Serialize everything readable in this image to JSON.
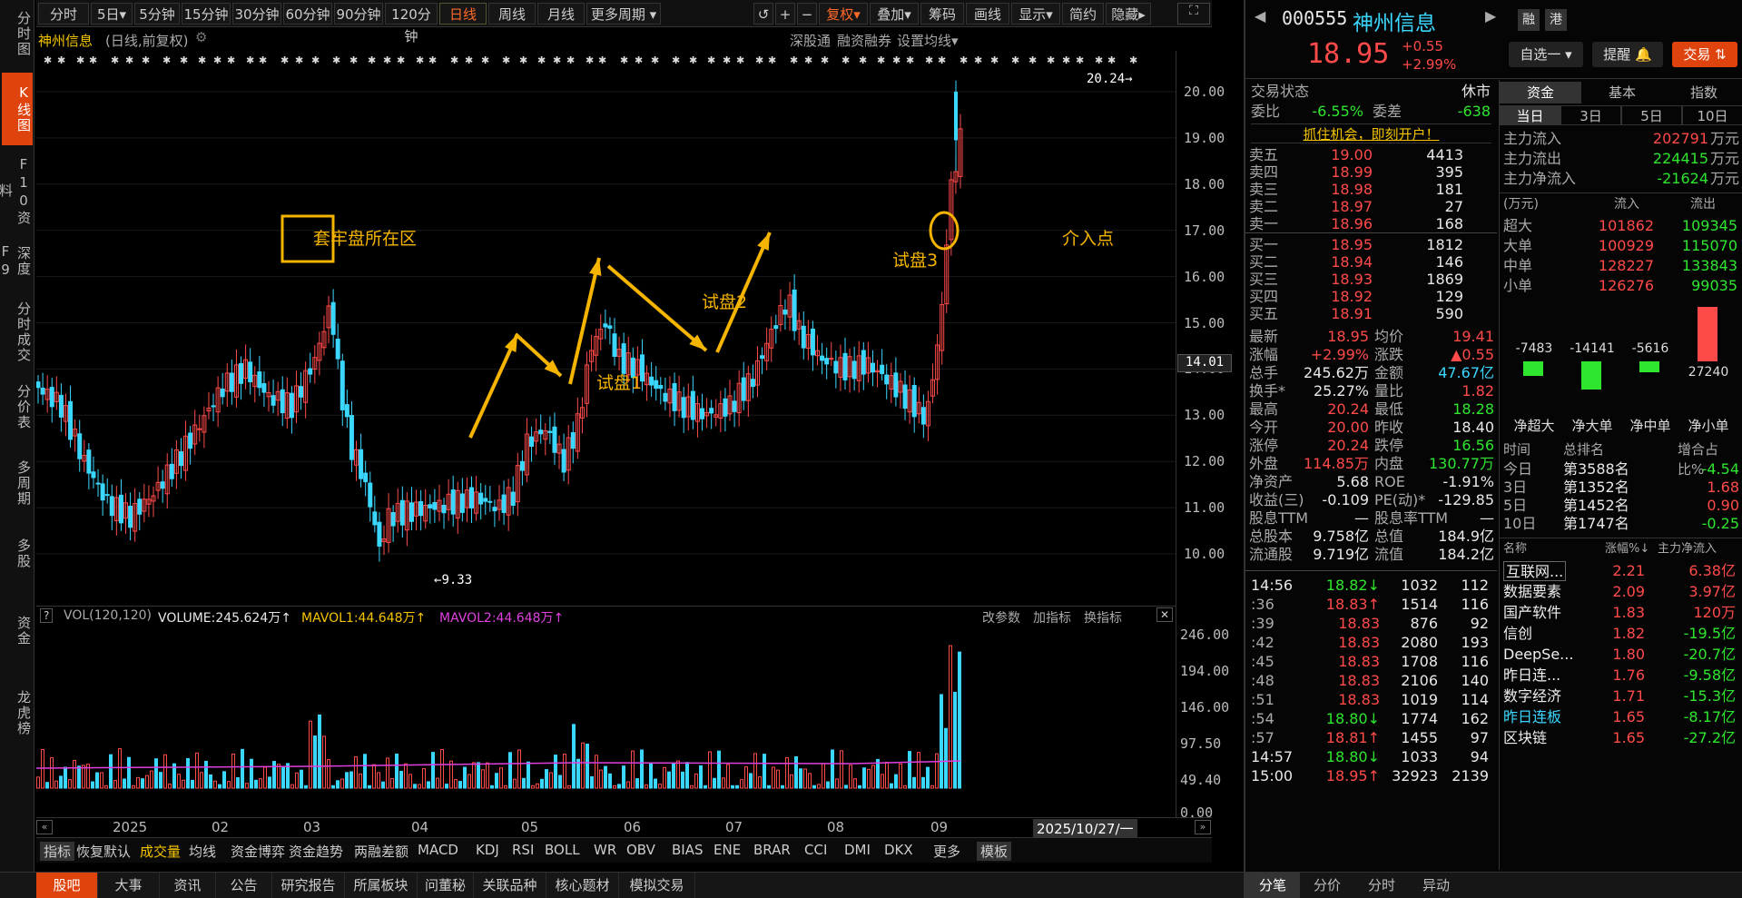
{
  "left_nav": [
    {
      "label": "分时图"
    },
    {
      "label": "K线图",
      "active": true
    },
    {
      "label": "F10资料"
    },
    {
      "label": "深度F9"
    },
    {
      "label": "分时成交"
    },
    {
      "label": "分价表"
    },
    {
      "label": "多周期"
    },
    {
      "label": "多股"
    },
    {
      "label": "资金"
    },
    {
      "label": "龙虎榜"
    }
  ],
  "toolbar": {
    "periods": [
      "分时",
      "5日▾",
      "5分钟",
      "15分钟",
      "30分钟",
      "60分钟",
      "90分钟",
      "120分钟",
      "日线",
      "周线",
      "月线",
      "更多周期 ▾"
    ],
    "active": "日线",
    "tools": [
      "复权▾",
      "叠加▾",
      "筹码",
      "画线",
      "显示▾",
      "简约",
      "隐藏▸"
    ]
  },
  "chart_header": {
    "name": "神州信息",
    "mode": "(日线,前复权)",
    "links": [
      "深股通",
      "融资融券",
      "设置均线▾"
    ]
  },
  "y_axis": [
    "20.00",
    "19.00",
    "18.00",
    "17.00",
    "16.00",
    "15.00",
    "14.00",
    "13.00",
    "12.00",
    "11.00",
    "10.00"
  ],
  "cursor_price": "14.01",
  "high_label": "20.24",
  "low_label": "9.33",
  "annotations": {
    "trapped": "套牢盘所在区",
    "t1": "试盘1",
    "t2": "试盘2",
    "t3": "试盘3",
    "entry": "介入点"
  },
  "x_axis": [
    "2025",
    "02",
    "03",
    "04",
    "05",
    "06",
    "07",
    "08",
    "09",
    "2025/10/27/一"
  ],
  "volume": {
    "title": "VOL(120,120)",
    "vol": "VOLUME:245.624万↑",
    "ma1": "MAVOL1:44.648万↑",
    "ma2": "MAVOL2:44.648万↑",
    "links": [
      "改参数",
      "加指标",
      "换指标"
    ],
    "y_axis": [
      "246.00",
      "194.00",
      "146.00",
      "97.50",
      "49.40",
      "0.00"
    ]
  },
  "chart_data": {
    "type": "candlestick",
    "x_range": [
      "2025-01",
      "2025-10-27"
    ],
    "y_range": [
      9.33,
      20.24
    ],
    "high": 20.24,
    "low": 9.33,
    "last_close": 18.95
  },
  "indicators": [
    "指标",
    "恢复默认",
    "成交量",
    "均线",
    "资金博弈",
    "资金趋势",
    "两融差额",
    "MACD",
    "KDJ",
    "RSI",
    "BOLL",
    "WR",
    "OBV",
    "BIAS",
    "ENE",
    "BRAR",
    "CCI",
    "DMI",
    "DKX",
    "更多",
    "模板"
  ],
  "bottom_tabs": [
    "股吧",
    "大事",
    "资讯",
    "公告",
    "研究报告",
    "所属板块",
    "问董秘",
    "关联品种",
    "核心题材",
    "模拟交易"
  ],
  "stock": {
    "code": "000555",
    "name": "神州信息",
    "price": "18.95",
    "chg": "+0.55",
    "pct": "+2.99%",
    "badges": [
      "融",
      "港"
    ]
  },
  "buttons": {
    "watch": "自选一 ▾",
    "alert": "提醒 🔔",
    "trade": "交易 ⇅"
  },
  "status": {
    "label": "交易状态",
    "value": "休市",
    "wb_label": "委比",
    "wb": "-6.55%",
    "wc_label": "委差",
    "wc": "-638",
    "promo": "抓住机会，即刻开户！"
  },
  "asks": [
    {
      "l": "卖五",
      "p": "19.00",
      "v": "4413"
    },
    {
      "l": "卖四",
      "p": "18.99",
      "v": "395"
    },
    {
      "l": "卖三",
      "p": "18.98",
      "v": "181"
    },
    {
      "l": "卖二",
      "p": "18.97",
      "v": "27"
    },
    {
      "l": "卖一",
      "p": "18.96",
      "v": "168"
    }
  ],
  "bids": [
    {
      "l": "买一",
      "p": "18.95",
      "v": "1812"
    },
    {
      "l": "买二",
      "p": "18.94",
      "v": "146"
    },
    {
      "l": "买三",
      "p": "18.93",
      "v": "1869"
    },
    {
      "l": "买四",
      "p": "18.92",
      "v": "129"
    },
    {
      "l": "买五",
      "p": "18.91",
      "v": "590"
    }
  ],
  "quote": [
    {
      "k1": "最新",
      "v1": "18.95",
      "c1": "red",
      "k2": "均价",
      "v2": "19.41",
      "c2": "red"
    },
    {
      "k1": "涨幅",
      "v1": "+2.99%",
      "c1": "red",
      "k2": "涨跌",
      "v2": "▲0.55",
      "c2": "red"
    },
    {
      "k1": "总手",
      "v1": "245.62万",
      "c1": "white",
      "k2": "金额",
      "v2": "47.67亿",
      "c2": "cyan"
    },
    {
      "k1": "换手*",
      "v1": "25.27%",
      "c1": "white",
      "k2": "量比",
      "v2": "1.82",
      "c2": "red"
    },
    {
      "k1": "最高",
      "v1": "20.24",
      "c1": "red",
      "k2": "最低",
      "v2": "18.28",
      "c2": "green"
    },
    {
      "k1": "今开",
      "v1": "20.00",
      "c1": "red",
      "k2": "昨收",
      "v2": "18.40",
      "c2": "white"
    },
    {
      "k1": "涨停",
      "v1": "20.24",
      "c1": "red",
      "k2": "跌停",
      "v2": "16.56",
      "c2": "green"
    },
    {
      "k1": "外盘",
      "v1": "114.85万",
      "c1": "red",
      "k2": "内盘",
      "v2": "130.77万",
      "c2": "green"
    },
    {
      "k1": "净资产",
      "v1": "5.68",
      "c1": "white",
      "k2": "ROE",
      "v2": "-1.91%",
      "c2": "white"
    },
    {
      "k1": "收益(三)",
      "v1": "-0.109",
      "c1": "white",
      "k2": "PE(动)*",
      "v2": "-129.85",
      "c2": "white"
    },
    {
      "k1": "股息TTM",
      "v1": "—",
      "c1": "white",
      "k2": "股息率TTM",
      "v2": "—",
      "c2": "white"
    },
    {
      "k1": "总股本",
      "v1": "9.758亿",
      "c1": "white",
      "k2": "总值",
      "v2": "184.9亿",
      "c2": "white"
    },
    {
      "k1": "流通股",
      "v1": "9.719亿",
      "c1": "white",
      "k2": "流值",
      "v2": "184.2亿",
      "c2": "white"
    }
  ],
  "ticks": [
    {
      "t": "14:56",
      "p": "18.82↓",
      "pc": "green",
      "v": "1032",
      "n": "112"
    },
    {
      "t": ":36",
      "p": "18.83↑",
      "pc": "red",
      "v": "1514",
      "n": "116"
    },
    {
      "t": ":39",
      "p": "18.83",
      "pc": "red",
      "v": "876",
      "n": "92"
    },
    {
      "t": ":42",
      "p": "18.83",
      "pc": "red",
      "v": "2080",
      "n": "193"
    },
    {
      "t": ":45",
      "p": "18.83",
      "pc": "red",
      "v": "1708",
      "n": "116"
    },
    {
      "t": ":48",
      "p": "18.83",
      "pc": "red",
      "v": "2106",
      "n": "140"
    },
    {
      "t": ":51",
      "p": "18.83",
      "pc": "red",
      "v": "1019",
      "n": "114"
    },
    {
      "t": ":54",
      "p": "18.80↓",
      "pc": "green",
      "v": "1774",
      "n": "162"
    },
    {
      "t": ":57",
      "p": "18.81↑",
      "pc": "red",
      "v": "1455",
      "n": "97"
    },
    {
      "t": "14:57",
      "p": "18.80↓",
      "pc": "green",
      "v": "1033",
      "n": "94"
    },
    {
      "t": "15:00",
      "p": "18.95↑",
      "pc": "red",
      "v": "32923",
      "n": "2139"
    }
  ],
  "right_tabs_top": [
    "资金",
    "基本",
    "指数"
  ],
  "periods_top": [
    "当日",
    "3日",
    "5日",
    "10日"
  ],
  "flow": [
    {
      "k": "主力流入",
      "v": "202791",
      "c": "red"
    },
    {
      "k": "主力流出",
      "v": "224415",
      "c": "green"
    },
    {
      "k": "主力净流入",
      "v": "-21624",
      "c": "green"
    }
  ],
  "flow_unit": "万元",
  "flow_head": [
    "(万元)",
    "流入",
    "流出"
  ],
  "flow_rows": [
    {
      "k": "超大",
      "i": "101862",
      "o": "109345"
    },
    {
      "k": "大单",
      "i": "100929",
      "o": "115070"
    },
    {
      "k": "中单",
      "i": "128227",
      "o": "133843"
    },
    {
      "k": "小单",
      "i": "126276",
      "o": "99035"
    }
  ],
  "netbars": [
    {
      "label": "净超大",
      "value": -7483
    },
    {
      "label": "净大单",
      "value": -14141
    },
    {
      "label": "净中单",
      "value": -5616
    },
    {
      "label": "净小单",
      "value": 27240
    }
  ],
  "rank_head": [
    "时间",
    "总排名",
    "增合占比%"
  ],
  "ranks": [
    {
      "t": "今日",
      "r": "第3588名",
      "p": "-4.54",
      "c": "green"
    },
    {
      "t": "3日",
      "r": "第1352名",
      "p": "1.68",
      "c": "red"
    },
    {
      "t": "5日",
      "r": "第1452名",
      "p": "0.90",
      "c": "red"
    },
    {
      "t": "10日",
      "r": "第1747名",
      "p": "-0.25",
      "c": "green"
    }
  ],
  "sector_head": [
    "名称",
    "涨幅%↓",
    "主力净流入"
  ],
  "sectors": [
    {
      "n": "互联网...",
      "p": "2.21",
      "f": "6.38亿",
      "fc": "red"
    },
    {
      "n": "数据要素",
      "p": "2.09",
      "f": "3.97亿",
      "fc": "red"
    },
    {
      "n": "国产软件",
      "p": "1.83",
      "f": "120万",
      "fc": "red"
    },
    {
      "n": "信创",
      "p": "1.82",
      "f": "-19.5亿",
      "fc": "green"
    },
    {
      "n": "DeepSe...",
      "p": "1.80",
      "f": "-20.7亿",
      "fc": "green"
    },
    {
      "n": "昨日连...",
      "p": "1.76",
      "f": "-9.58亿",
      "fc": "green"
    },
    {
      "n": "数字经济",
      "p": "1.71",
      "f": "-15.3亿",
      "fc": "green"
    },
    {
      "n": "昨日连板",
      "p": "1.65",
      "f": "-8.17亿",
      "fc": "green"
    },
    {
      "n": "区块链",
      "p": "1.65",
      "f": "-27.2亿",
      "fc": "green"
    }
  ],
  "right_bottom_tabs": [
    "分笔",
    "分价",
    "分时",
    "异动"
  ]
}
